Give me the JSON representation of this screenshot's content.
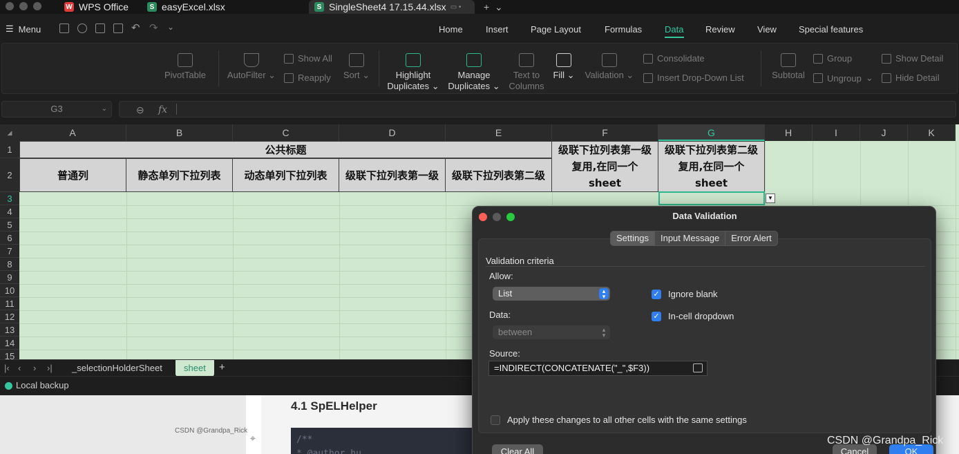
{
  "tabs": [
    {
      "label": "WPS Office",
      "icon": "wps-logo-icon"
    },
    {
      "label": "easyExcel.xlsx",
      "icon": "spreadsheet-icon"
    },
    {
      "label": "SingleSheet4 17.15.44.xlsx",
      "icon": "spreadsheet-icon",
      "active": true
    }
  ],
  "menu": {
    "label": "Menu",
    "nav": [
      "Home",
      "Insert",
      "Page Layout",
      "Formulas",
      "Data",
      "Review",
      "View",
      "Special features"
    ],
    "active": "Data"
  },
  "ribbon": {
    "pivot": "PivotTable",
    "autofilter": "AutoFilter",
    "show_all": "Show All",
    "reapply": "Reapply",
    "sort": "Sort",
    "highlight_1": "Highlight",
    "highlight_2": "Duplicates",
    "manage_1": "Manage",
    "manage_2": "Duplicates",
    "ttc_1": "Text to",
    "ttc_2": "Columns",
    "fill": "Fill",
    "validation": "Validation",
    "consolidate": "Consolidate",
    "insert_dd": "Insert Drop-Down List",
    "subtotal": "Subtotal",
    "group": "Group",
    "ungroup": "Ungroup",
    "show_detail": "Show Detail",
    "hide_detail": "Hide Detail"
  },
  "formula_bar": {
    "cell_ref": "G3",
    "fx": "fx",
    "value": ""
  },
  "sheet": {
    "columns": [
      "A",
      "B",
      "C",
      "D",
      "E",
      "F",
      "G",
      "H",
      "I",
      "J",
      "K"
    ],
    "rows": [
      "1",
      "2",
      "3",
      "4",
      "5",
      "6",
      "7",
      "8",
      "9",
      "10",
      "11",
      "12",
      "13",
      "14",
      "15"
    ],
    "selected_col": "G",
    "selected_row": "3",
    "header_merged": "公共标题",
    "headers": [
      "普通列",
      "静态单列下拉列表",
      "动态单列下拉列表",
      "级联下拉列表第一级",
      "级联下拉列表第二级"
    ],
    "header_f": "级联下拉列表第一级复用,在同一个sheet",
    "header_g": "级联下拉列表第二级复用,在同一个sheet"
  },
  "sheet_tabs": {
    "tabs": [
      "_selectionHolderSheet",
      "sheet"
    ],
    "active": "sheet",
    "add": "+"
  },
  "status": {
    "backup": "Local backup"
  },
  "background": {
    "article_title": "4.1 SpELHelper",
    "code_line_1": "/**",
    "code_line_2": " * @author hu",
    "small_watermark": "CSDN @Grandpa_Rick"
  },
  "dialog": {
    "title": "Data Validation",
    "tabs": [
      "Settings",
      "Input Message",
      "Error Alert"
    ],
    "active_tab": "Settings",
    "criteria": "Validation criteria",
    "allow_label": "Allow:",
    "allow_value": "List",
    "ignore_blank": "Ignore blank",
    "ignore_blank_checked": true,
    "in_cell_dropdown": "In-cell dropdown",
    "in_cell_checked": true,
    "data_label": "Data:",
    "data_value": "between",
    "source_label": "Source:",
    "source_value": "=INDIRECT(CONCATENATE(\"_\",$F3))",
    "apply_all": "Apply these changes to all other cells with the same settings",
    "apply_all_checked": false,
    "clear_all": "Clear All",
    "cancel": "Cancel",
    "ok": "OK"
  },
  "watermark": "CSDN @Grandpa_Rick",
  "colors": {
    "accent": "#35c6a0",
    "sheet_bg": "#cfe8cf",
    "header_cell": "#d4d4d4",
    "checkbox": "#2f7ff0"
  }
}
